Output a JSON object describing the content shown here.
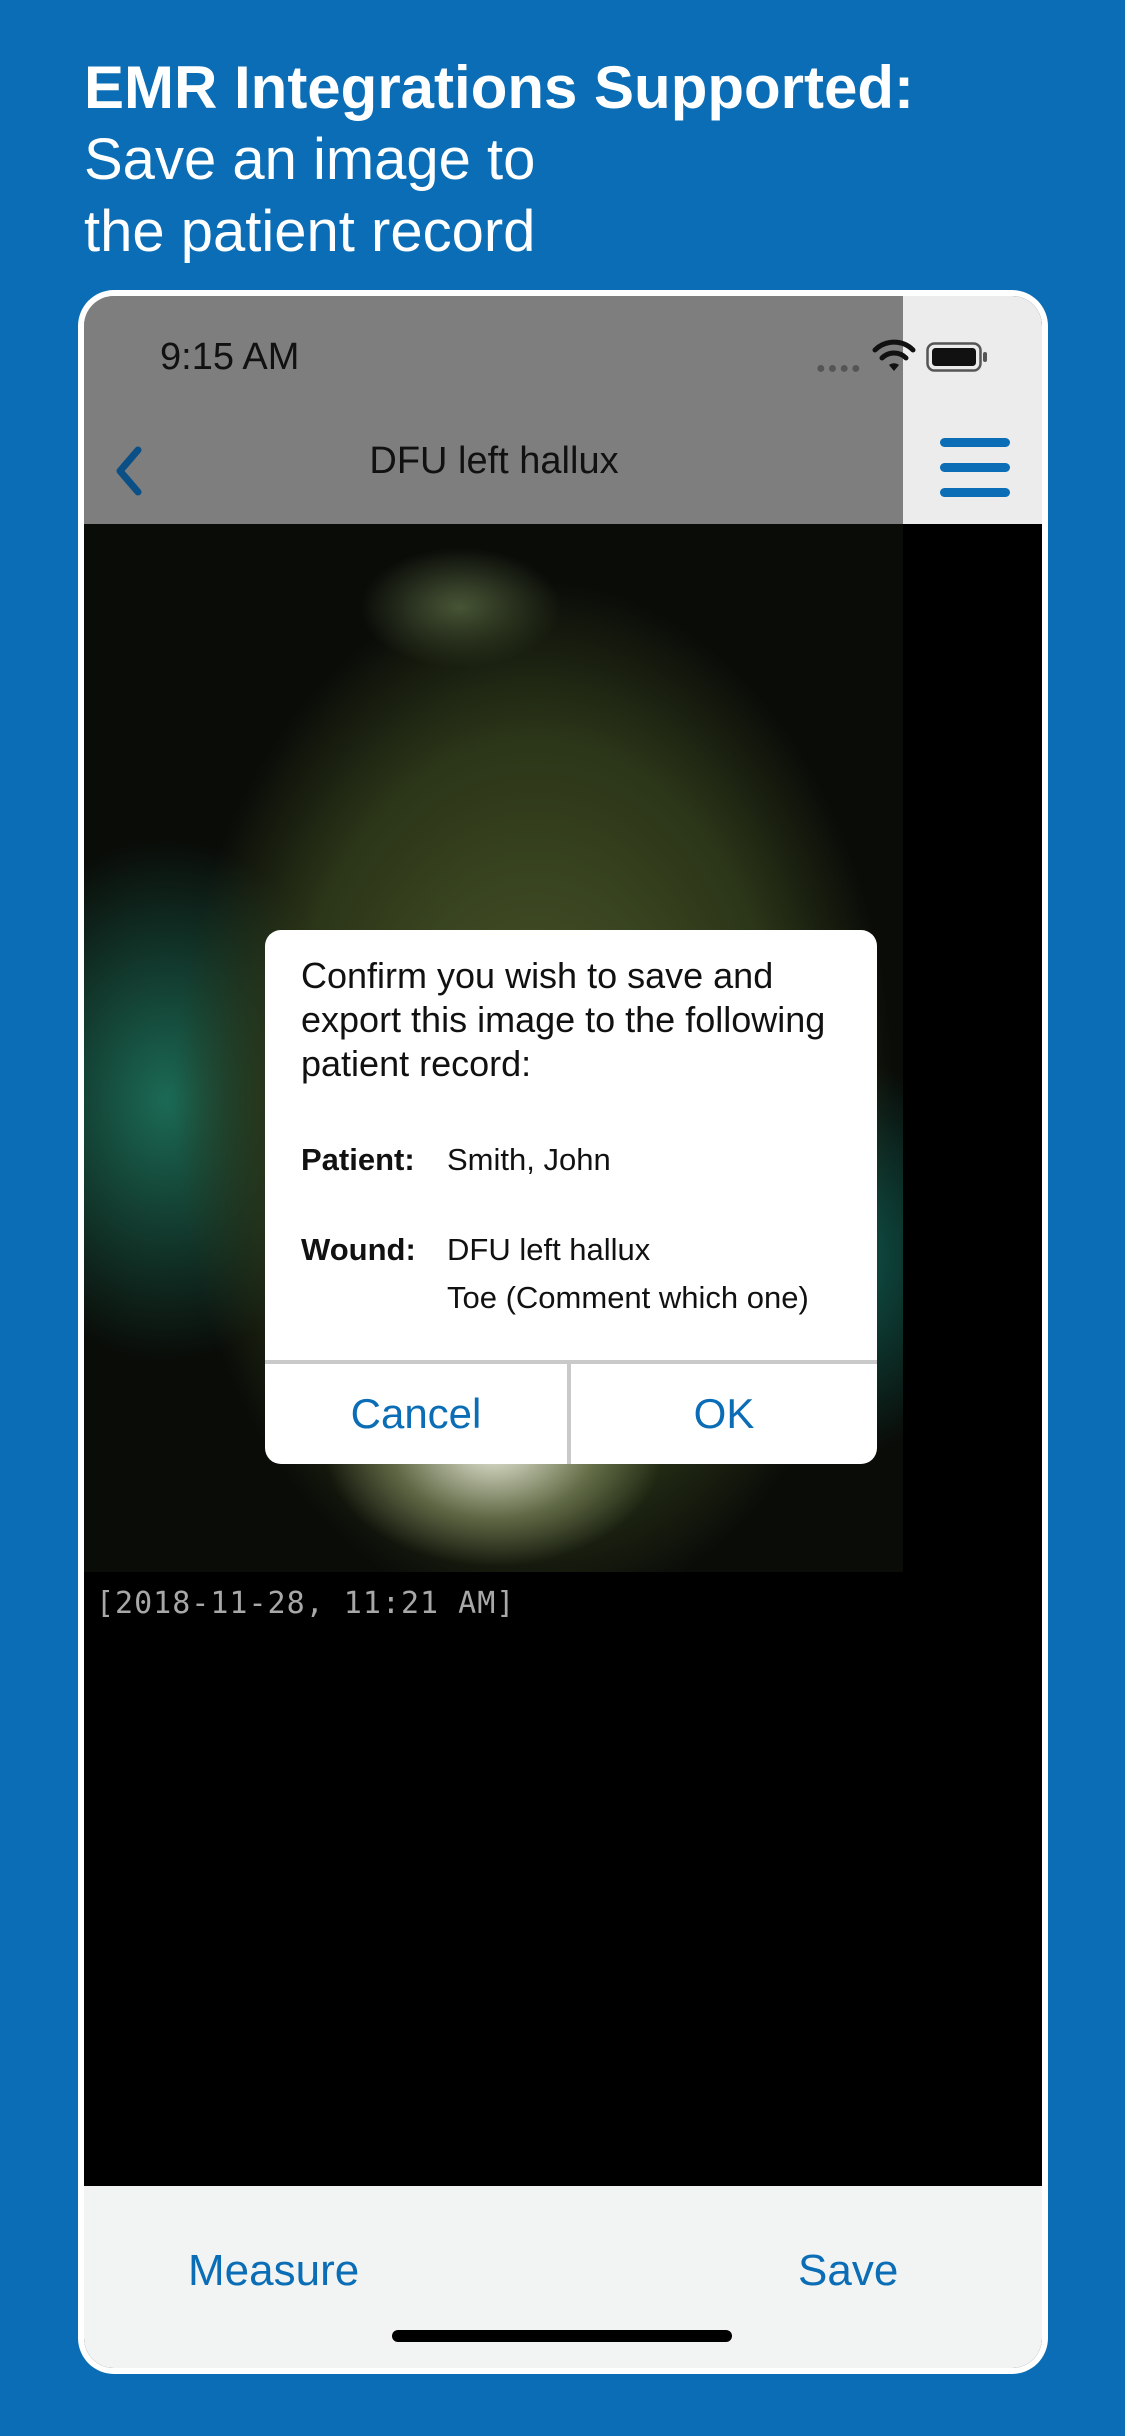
{
  "headline": {
    "bold": "EMR Integrations Supported:",
    "line2": "Save an image to",
    "line3": "the patient record"
  },
  "status_bar": {
    "time": "9:15 AM",
    "icons": [
      "signal-dots-icon",
      "wifi-icon",
      "battery-icon"
    ]
  },
  "nav": {
    "title": "DFU left hallux",
    "back_icon": "chevron-left-icon",
    "menu_icon": "hamburger-menu-icon"
  },
  "photo": {
    "timestamp": "[2018-11-28, 11:21 AM]"
  },
  "dialog": {
    "message": "Confirm you wish to save and export this image to the following patient record:",
    "patient_label": "Patient:",
    "patient_value": "Smith, John",
    "wound_label": "Wound:",
    "wound_value": "DFU left hallux",
    "wound_detail": "Toe (Comment which one)",
    "cancel_label": "Cancel",
    "ok_label": "OK"
  },
  "toolbar": {
    "measure_label": "Measure",
    "save_label": "Save"
  },
  "colors": {
    "brand_blue": "#0a6db5",
    "background": "#0a6db5"
  }
}
